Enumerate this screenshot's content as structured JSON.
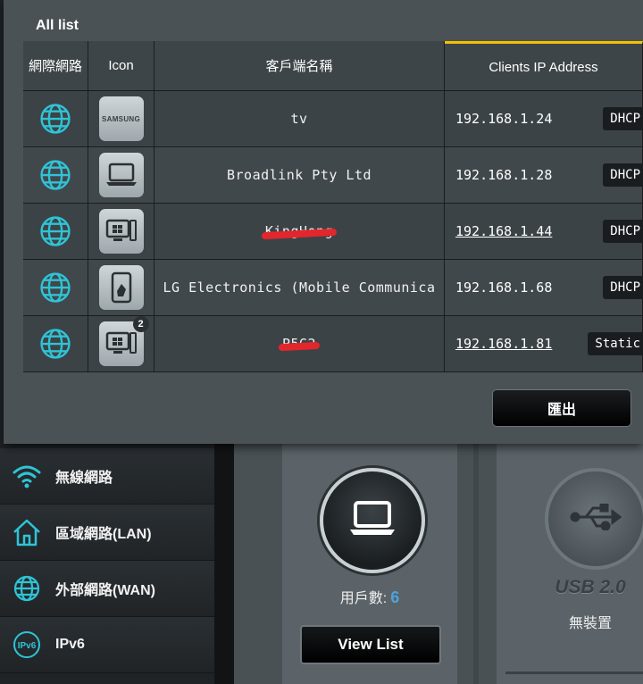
{
  "modal": {
    "title": "All list",
    "columns": {
      "network": "網際網路",
      "icon": "Icon",
      "client_name": "客戶端名稱",
      "ip": "Clients IP Address"
    },
    "rows": [
      {
        "name": "tv",
        "ip": "192.168.1.24",
        "type": "DHCP",
        "icon": "samsung-tv-icon",
        "icon_text": "SAMSUNG"
      },
      {
        "name": "Broadlink Pty Ltd",
        "ip": "192.168.1.28",
        "type": "DHCP",
        "icon": "laptop-icon"
      },
      {
        "name": "KingHong",
        "ip": "192.168.1.44",
        "type": "DHCP",
        "icon": "windows-desktop-icon"
      },
      {
        "name": "LG Electronics (Mobile Communica",
        "ip": "192.168.1.68",
        "type": "DHCP",
        "icon": "phone-icon"
      },
      {
        "name": "P5G2",
        "ip": "192.168.1.81",
        "type": "Static",
        "icon": "windows-desktop-icon",
        "badge": "2"
      }
    ],
    "export_label": "匯出"
  },
  "sidebar": {
    "items": [
      {
        "label": "無線網路",
        "icon": "wifi-icon"
      },
      {
        "label": "區域網路(LAN)",
        "icon": "home-icon"
      },
      {
        "label": "外部網路(WAN)",
        "icon": "globe-icon"
      },
      {
        "label": "IPv6",
        "icon": "ipv6-icon"
      }
    ]
  },
  "clients_card": {
    "count_label": "用戶數:",
    "count": "6",
    "view_list_label": "View List"
  },
  "usb_card": {
    "title": "USB 2.0",
    "status": "無裝置"
  },
  "colors": {
    "accent_yellow": "#f2c200",
    "globe_cyan": "#2fc4d6",
    "count_blue": "#4fa3d9",
    "redaction_red": "#e3262b"
  }
}
